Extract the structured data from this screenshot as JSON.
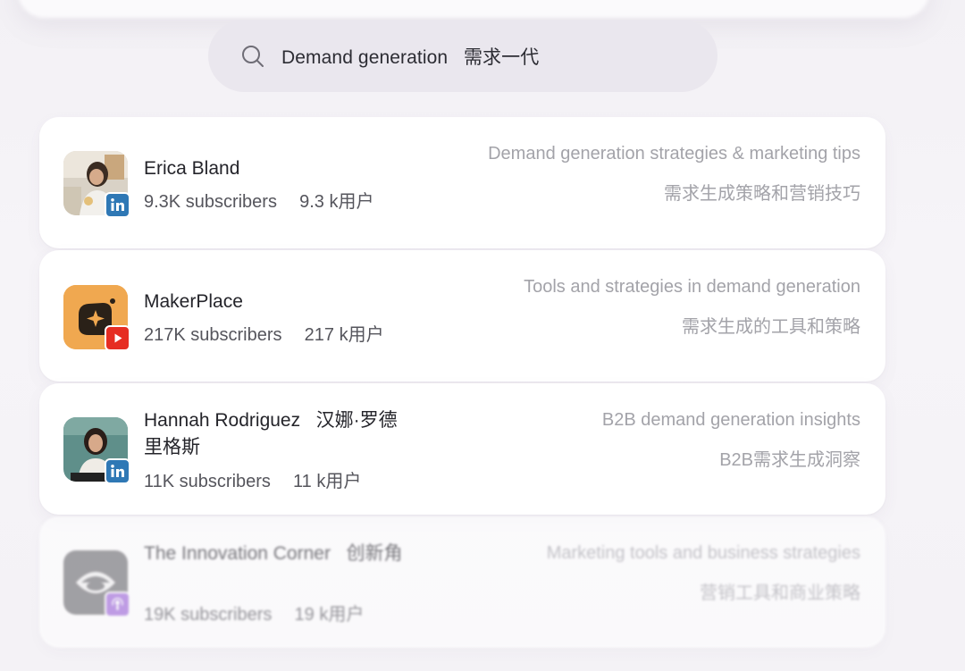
{
  "search": {
    "icon": "search-icon",
    "query": "Demand generation   需求一代"
  },
  "results": [
    {
      "name": "Erica Bland",
      "subscribers": "9.3K subscribers",
      "subscribers_cn": "9.3 k用户",
      "platform": "linkedin-icon",
      "description": "Demand generation strategies & marketing tips",
      "description_cn": "需求生成策略和营销技巧"
    },
    {
      "name": "MakerPlace",
      "subscribers": "217K subscribers",
      "subscribers_cn": "217 k用户",
      "platform": "youtube-icon",
      "description": "Tools and strategies in demand generation",
      "description_cn": "需求生成的工具和策略"
    },
    {
      "name": "Hannah Rodriguez   汉娜·罗德里格斯",
      "subscribers": "11K subscribers",
      "subscribers_cn": "11 k用户",
      "platform": "linkedin-icon",
      "description": "B2B demand generation insights",
      "description_cn": "B2B需求生成洞察"
    },
    {
      "name": "The Innovation Corner   创新角",
      "subscribers": "19K subscribers",
      "subscribers_cn": "19 k用户",
      "platform": "podcast-icon",
      "description": "Marketing tools and business strategies",
      "description_cn": "营销工具和商业策略"
    }
  ],
  "colors": {
    "linkedin": "#2f78b5",
    "youtube": "#e62d22",
    "podcast": "#9b63d9",
    "makerplace_bg": "#f0a850"
  }
}
